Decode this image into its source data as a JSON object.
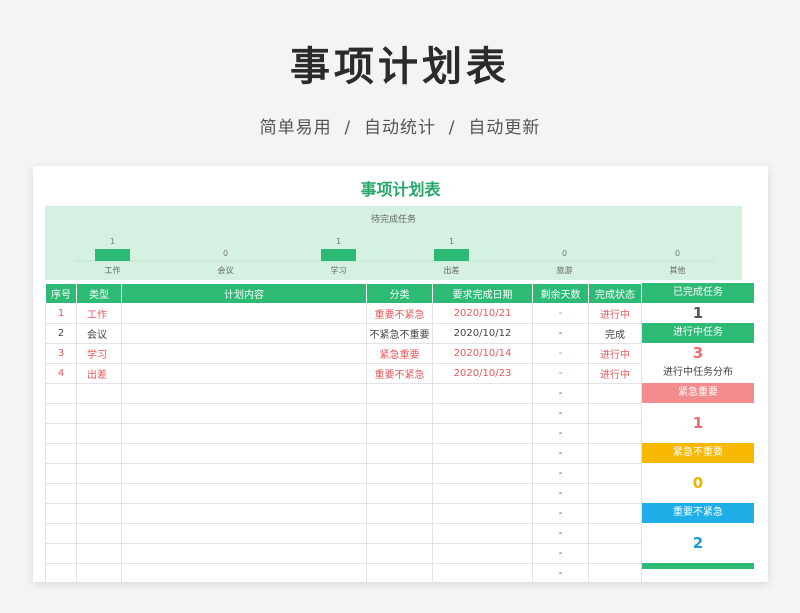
{
  "hero": {
    "title": "事项计划表",
    "subtitle": "简单易用  /  自动统计  /  自动更新"
  },
  "sheet": {
    "title": "事项计划表"
  },
  "chart_data": {
    "type": "bar",
    "title": "待完成任务",
    "categories": [
      "工作",
      "会议",
      "学习",
      "出差",
      "旅游",
      "其他"
    ],
    "values": [
      1,
      0,
      1,
      1,
      0,
      0
    ],
    "ylim": [
      0,
      1
    ],
    "bar_color": "#2dba75",
    "grid": false,
    "legend": "none"
  },
  "table": {
    "headers": [
      "序号",
      "类型",
      "计划内容",
      "分类",
      "要求完成日期",
      "剩余天数",
      "完成状态"
    ],
    "rows": [
      {
        "no": "1",
        "type": "工作",
        "content": "",
        "category": "重要不紧急",
        "date": "2020/10/21",
        "remaining": "-",
        "status": "进行中",
        "highlight": true
      },
      {
        "no": "2",
        "type": "会议",
        "content": "",
        "category": "不紧急不重要",
        "date": "2020/10/12",
        "remaining": "-",
        "status": "完成",
        "highlight": false
      },
      {
        "no": "3",
        "type": "学习",
        "content": "",
        "category": "紧急重要",
        "date": "2020/10/14",
        "remaining": "-",
        "status": "进行中",
        "highlight": true
      },
      {
        "no": "4",
        "type": "出差",
        "content": "",
        "category": "重要不紧急",
        "date": "2020/10/23",
        "remaining": "-",
        "status": "进行中",
        "highlight": true
      },
      {
        "no": "",
        "type": "",
        "content": "",
        "category": "",
        "date": "",
        "remaining": "-",
        "status": "",
        "highlight": false
      },
      {
        "no": "",
        "type": "",
        "content": "",
        "category": "",
        "date": "",
        "remaining": "-",
        "status": "",
        "highlight": false
      },
      {
        "no": "",
        "type": "",
        "content": "",
        "category": "",
        "date": "",
        "remaining": "-",
        "status": "",
        "highlight": false
      },
      {
        "no": "",
        "type": "",
        "content": "",
        "category": "",
        "date": "",
        "remaining": "-",
        "status": "",
        "highlight": false
      },
      {
        "no": "",
        "type": "",
        "content": "",
        "category": "",
        "date": "",
        "remaining": "-",
        "status": "",
        "highlight": false
      },
      {
        "no": "",
        "type": "",
        "content": "",
        "category": "",
        "date": "",
        "remaining": "-",
        "status": "",
        "highlight": false
      },
      {
        "no": "",
        "type": "",
        "content": "",
        "category": "",
        "date": "",
        "remaining": "-",
        "status": "",
        "highlight": false
      },
      {
        "no": "",
        "type": "",
        "content": "",
        "category": "",
        "date": "",
        "remaining": "-",
        "status": "",
        "highlight": false
      },
      {
        "no": "",
        "type": "",
        "content": "",
        "category": "",
        "date": "",
        "remaining": "-",
        "status": "",
        "highlight": false
      },
      {
        "no": "",
        "type": "",
        "content": "",
        "category": "",
        "date": "",
        "remaining": "-",
        "status": "",
        "highlight": false
      }
    ]
  },
  "summary": {
    "completed_label": "已完成任务",
    "completed_value": "1",
    "inprogress_label": "进行中任务",
    "inprogress_value": "3",
    "distribution_label": "进行中任务分布",
    "urgent_important_label": "紧急重要",
    "urgent_important_value": "1",
    "urgent_unimportant_label": "紧急不重要",
    "urgent_unimportant_value": "0",
    "important_nonurgent_label": "重要不紧急",
    "important_nonurgent_value": "2"
  },
  "colors": {
    "green": "#2dba75",
    "red": "#f48b8c",
    "yellow": "#f8b800",
    "blue": "#1faee8",
    "value_red": "#ef6b6f",
    "value_yellow": "#e6b800",
    "value_blue": "#1a9ad6"
  }
}
